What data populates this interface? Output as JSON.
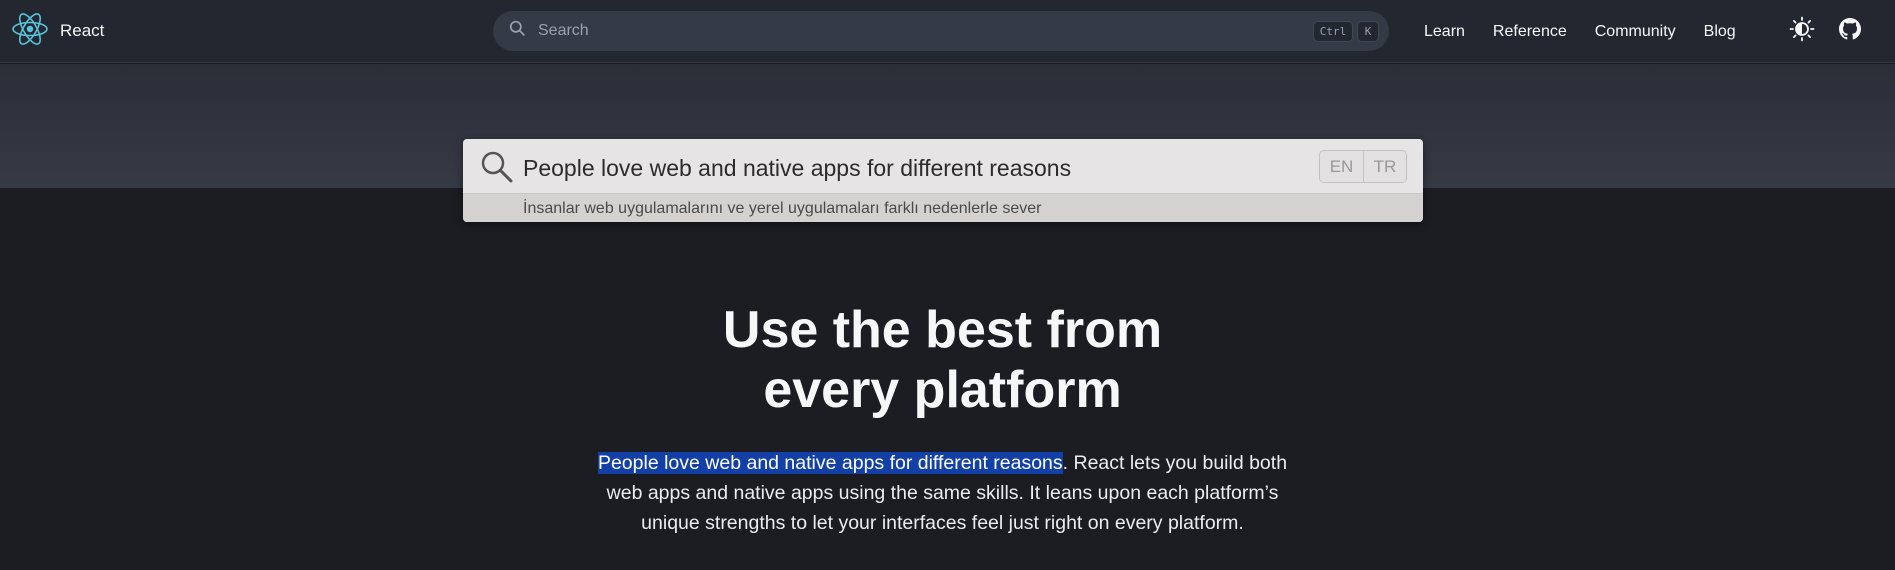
{
  "brand": {
    "name": "React",
    "logo_icon": "react-logo-icon",
    "accent": "#58c4dc"
  },
  "search": {
    "placeholder": "Search",
    "shortcut_ctrl": "Ctrl",
    "shortcut_key": "K"
  },
  "nav": {
    "items": [
      "Learn",
      "Reference",
      "Community",
      "Blog"
    ]
  },
  "icons": {
    "theme": "sun-moon-icon",
    "github": "github-icon"
  },
  "translator": {
    "source_text": "People love web and native apps for different reasons",
    "translation": "İnsanlar web uygulamalarını ve yerel uygulamaları farklı nedenlerle sever",
    "lang_from": "EN",
    "lang_to": "TR"
  },
  "hero": {
    "title_line1": "Use the best from",
    "title_line2": "every platform",
    "desc_highlight": "People love web and native apps for different reasons",
    "desc_rest_1": ". React lets you build both",
    "desc_line2": "web apps and native apps using the same skills. It leans upon each platform’s",
    "desc_line3": "unique strengths to let your interfaces feel just right on every platform.",
    "highlight_color": "#1240a6"
  }
}
